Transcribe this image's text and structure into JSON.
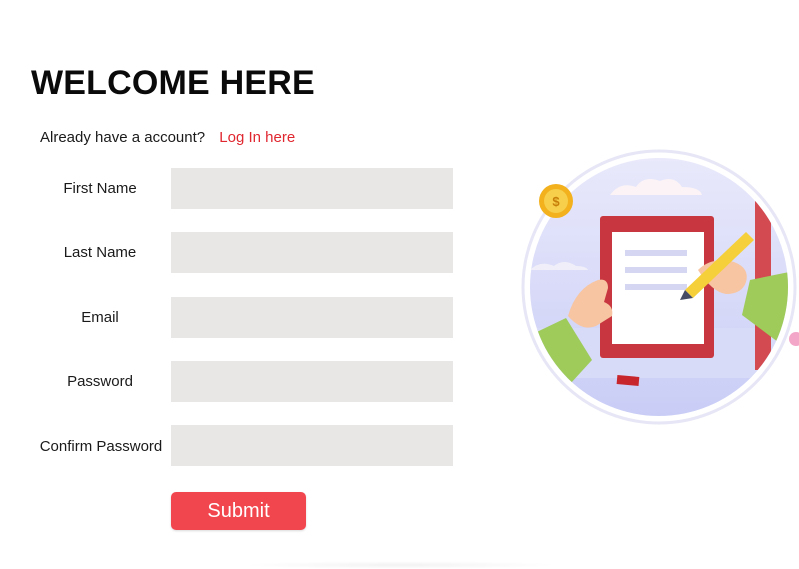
{
  "header": {
    "title": "WELCOME HERE"
  },
  "login": {
    "question": "Already have a account?",
    "link_label": "Log In here"
  },
  "form": {
    "fields": [
      {
        "label": "First Name",
        "value": ""
      },
      {
        "label": "Last Name",
        "value": ""
      },
      {
        "label": "Email",
        "value": ""
      },
      {
        "label": "Password",
        "value": ""
      },
      {
        "label": "Confirm Password",
        "value": ""
      }
    ],
    "submit_label": "Submit"
  },
  "illustration": {
    "coin_symbol": "$",
    "icon": "signing-document-illustration"
  },
  "colors": {
    "accent": "#f2464f",
    "link": "#e0262f",
    "input_bg": "#e8e7e5",
    "title": "#0a0a0a"
  }
}
